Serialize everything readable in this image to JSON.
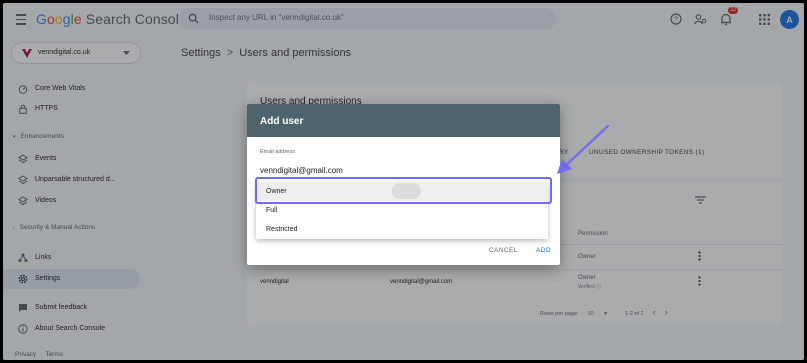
{
  "app": {
    "name_parts": [
      "G",
      "o",
      "o",
      "g",
      "l",
      "e"
    ],
    "product": "Search Console"
  },
  "search": {
    "placeholder": "Inspect any URL in \"venndigital.co.uk\""
  },
  "notifications": {
    "count": "12"
  },
  "user": {
    "avatar_letter": "A"
  },
  "property": {
    "name": "venndigital.co.uk"
  },
  "sidebar": {
    "items": [
      {
        "label": "Core Web Vitals",
        "icon": "gauge-icon"
      },
      {
        "label": "HTTPS",
        "icon": "lock-icon"
      },
      {
        "label": "Events",
        "icon": "layers-icon"
      },
      {
        "label": "Unparsable structured d...",
        "icon": "layers-icon"
      },
      {
        "label": "Videos",
        "icon": "layers-icon"
      },
      {
        "label": "Links",
        "icon": "links-icon"
      },
      {
        "label": "Settings",
        "icon": "gear-icon",
        "active": true
      },
      {
        "label": "Submit feedback",
        "icon": "feedback-icon"
      },
      {
        "label": "About Search Console",
        "icon": "info-icon"
      }
    ],
    "sections": {
      "enhancements": "Enhancements",
      "security": "Security & Manual Actions"
    },
    "footer": {
      "privacy": "Privacy",
      "terms": "Terms"
    }
  },
  "breadcrumb": {
    "root": "Settings",
    "separator": ">",
    "current": "Users and permissions"
  },
  "card": {
    "title": "Users and permissions",
    "tab_partial": "RY",
    "tab_unused": "UNUSED OWNERSHIP TOKENS (1)"
  },
  "table": {
    "permission_header": "Permission",
    "rows": [
      {
        "name": "",
        "email": "",
        "permission": "Owner",
        "sub": ""
      },
      {
        "name": "venndigital",
        "email": "venndigital@gmail.com",
        "permission": "Owner",
        "sub": "Verified"
      }
    ],
    "pager": {
      "rows_per_page_label": "Rows per page:",
      "rows_per_page": "10",
      "range": "1-2 of 2"
    }
  },
  "dialog": {
    "title": "Add user",
    "email_label": "Email address",
    "email_value": "venndigital@gmail.com",
    "options": [
      "Owner",
      "Full",
      "Restricted"
    ],
    "selected": "Owner",
    "cancel": "CANCEL",
    "add": "ADD"
  },
  "colors": {
    "accent": "#1a73e8",
    "dialog_header": "#4d646f",
    "highlight": "#6f6bf2"
  }
}
